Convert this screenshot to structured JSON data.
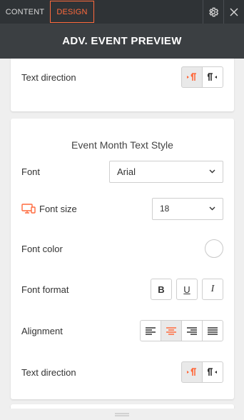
{
  "tabs": {
    "content": "CONTENT",
    "design": "DESIGN"
  },
  "header": {
    "title": "ADV. EVENT PREVIEW"
  },
  "top_section": {
    "text_direction_label": "Text direction"
  },
  "month_style": {
    "title": "Event Month Text Style",
    "font_label": "Font",
    "font_value": "Arial",
    "font_size_label": "Font size",
    "font_size_value": "18",
    "font_color_label": "Font color",
    "font_format_label": "Font format",
    "font_format_buttons": [
      "B",
      "U",
      "I"
    ],
    "alignment_label": "Alignment",
    "text_direction_label": "Text direction"
  },
  "icons": {
    "settings": "gear-icon",
    "close": "close-icon",
    "device": "desktop-mobile-icon",
    "dropdown": "chevron-down-icon"
  },
  "colors": {
    "accent": "#ff6a3d",
    "topbar": "#2f3336",
    "header": "#3b3f42"
  }
}
